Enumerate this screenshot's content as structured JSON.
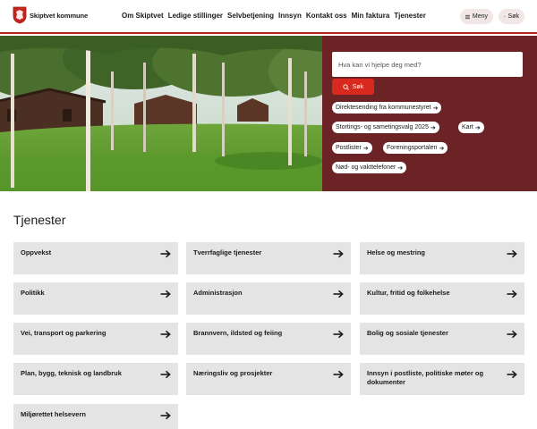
{
  "header": {
    "logo_text": "Skiptvet kommune",
    "nav": [
      "Om Skiptvet",
      "Ledige stillinger",
      "Selvbetjening",
      "Innsyn",
      "Kontakt oss",
      "Min faktura",
      "Tjenester"
    ],
    "menu_label": "Meny",
    "search_label": "Søk",
    "accent_color": "#b5221d"
  },
  "hero": {
    "search_placeholder": "Hva kan vi hjelpe deg med?",
    "search_button": "Søk",
    "panel_color": "#6b2325",
    "quick_links": [
      "Direktesending fra kommunestyret",
      "Stortings- og sametingsvalg 2025",
      "Kart",
      "Postlister",
      "Foreningsportalen",
      "Nød- og vakttelefoner"
    ]
  },
  "services": {
    "title": "Tjenester",
    "items": [
      "Oppvekst",
      "Tverrfaglige tjenester",
      "Helse og mestring",
      "Politikk",
      "Administrasjon",
      "Kultur, fritid og folkehelse",
      "Vei, transport og parkering",
      "Brannvern, ildsted og feiing",
      "Bolig og sosiale tjenester",
      "Plan, bygg, teknisk og landbruk",
      "Næringsliv og prosjekter",
      "Innsyn i postliste, politiske møter og dokumenter",
      "Miljørettet helsevern"
    ]
  }
}
